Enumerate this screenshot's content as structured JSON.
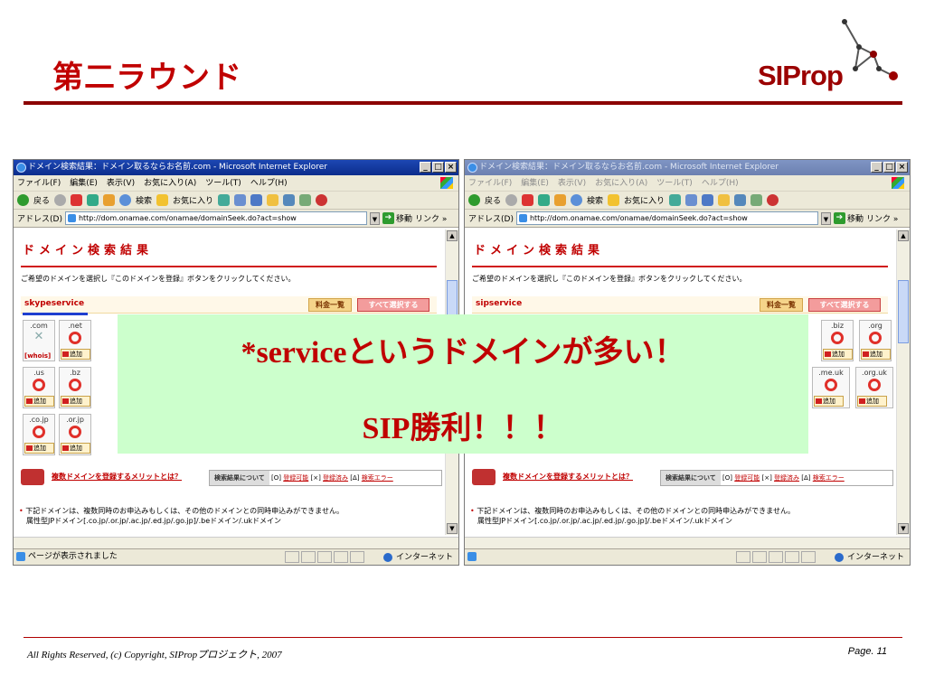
{
  "slide": {
    "title": "第二ラウンド",
    "logo_text": "SIProp",
    "footer_left": "All Rights Reserved, (c) Copyright, SIPropプロジェクト, 2007",
    "footer_right": "Page. 11"
  },
  "overlay": {
    "line1": "*serviceというドメインが多い！",
    "line2": "SIP勝利！！！"
  },
  "browser_left": {
    "title": "ドメイン検索結果：ドメイン取るならお名前.com - Microsoft Internet Explorer",
    "menu": [
      "ファイル(F)",
      "編集(E)",
      "表示(V)",
      "お気に入り(A)",
      "ツール(T)",
      "ヘルプ(H)"
    ],
    "toolbar": {
      "back": "戻る",
      "search": "検索",
      "favorites": "お気に入り"
    },
    "address_label": "アドレス(D)",
    "address_url": "http://dom.onamae.com/onamae/domainSeek.do?act=show",
    "go_label": "移動",
    "links_label": "リンク »",
    "page_heading": "ドメイン検索結果",
    "instruction": "ご希望のドメインを選択し『このドメインを登録』ボタンをクリックしてください。",
    "domain_name": "skypeservice",
    "price_button": "料金一覧",
    "select_all_button": "すべて選択する",
    "cells": [
      {
        "tld": ".com",
        "whois": "[whois]"
      },
      {
        "tld": ".net",
        "add": "追加"
      },
      {
        "tld": ".us",
        "add": "追加"
      },
      {
        "tld": ".bz",
        "add": "追加"
      },
      {
        "tld": ".co.jp",
        "add": "追加"
      },
      {
        "tld": ".or.jp",
        "add": "追加"
      }
    ],
    "merit_link": "複数ドメインを登録するメリットとは？",
    "result_legend": {
      "head": "検索結果について",
      "ok_sym": "[O]",
      "ok": "登録可能",
      "taken_sym": "[×]",
      "taken": "登録済み",
      "err_sym": "[Δ]",
      "err": "検索エラー"
    },
    "note_line1": "下記ドメインは、複数同時のお申込みもしくは、その他のドメインとの同時申込みができません。",
    "note_line2": "属性型JPドメイン[.co.jp/.or.jp/.ac.jp/.ed.jp/.go.jp]/.beドメイン/.ukドメイン",
    "status_text": "ページが表示されました",
    "zone": "インターネット"
  },
  "browser_right": {
    "title": "ドメイン検索結果：ドメイン取るならお名前.com - Microsoft Internet Explorer",
    "menu": [
      "ファイル(F)",
      "編集(E)",
      "表示(V)",
      "お気に入り(A)",
      "ツール(T)",
      "ヘルプ(H)"
    ],
    "toolbar": {
      "back": "戻る",
      "search": "検索",
      "favorites": "お気に入り"
    },
    "address_label": "アドレス(D)",
    "address_url": "http://dom.onamae.com/onamae/domainSeek.do?act=show",
    "go_label": "移動",
    "links_label": "リンク »",
    "page_heading": "ドメイン検索結果",
    "instruction": "ご希望のドメインを選択し『このドメインを登録』ボタンをクリックしてください。",
    "domain_name": "sipservice",
    "price_button": "料金一覧",
    "select_all_button": "すべて選択する",
    "cells": [
      {
        "tld": ".biz",
        "add": "追加"
      },
      {
        "tld": ".org",
        "add": "追加"
      },
      {
        "tld": ".me.uk",
        "add": "追加"
      },
      {
        "tld": ".org.uk",
        "add": "追加"
      }
    ],
    "merit_link": "複数ドメインを登録するメリットとは？",
    "result_legend": {
      "head": "検索結果について",
      "ok_sym": "[O]",
      "ok": "登録可能",
      "taken_sym": "[×]",
      "taken": "登録済み",
      "err_sym": "[Δ]",
      "err": "検索エラー"
    },
    "note_line1": "下記ドメインは、複数同時のお申込みもしくは、その他のドメインとの同時申込みができません。",
    "note_line2": "属性型JPドメイン[.co.jp/.or.jp/.ac.jp/.ed.jp/.go.jp]/.beドメイン/.ukドメイン",
    "zone": "インターネット"
  }
}
